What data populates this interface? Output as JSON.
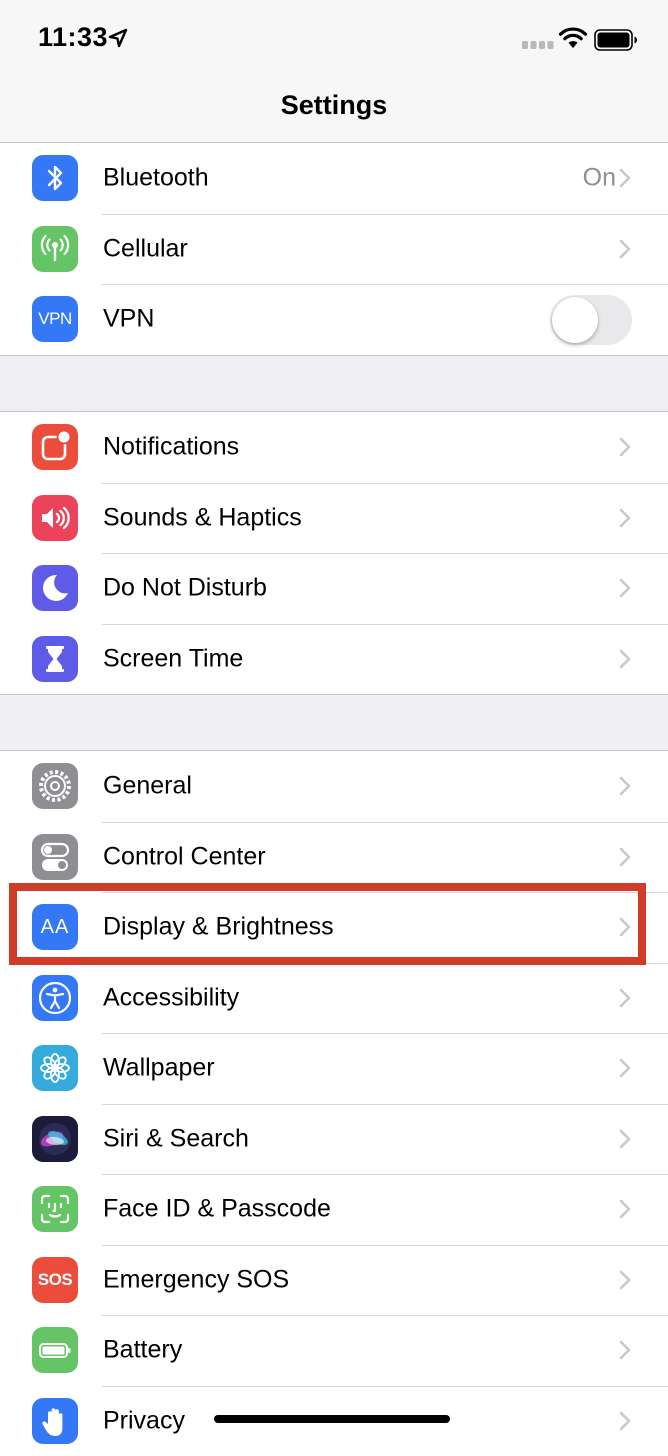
{
  "status_bar": {
    "time": "11:33",
    "icons": [
      "location-arrow-icon",
      "cellular-signal-icon",
      "wifi-icon",
      "battery-icon"
    ]
  },
  "nav": {
    "title": "Settings"
  },
  "groups": [
    {
      "rows": [
        {
          "id": "bluetooth",
          "label": "Bluetooth",
          "value": "On",
          "icon": "bluetooth-icon",
          "icon_color": "#3478f6",
          "accessory": "chevron"
        },
        {
          "id": "cellular",
          "label": "Cellular",
          "icon": "cellular-antenna-icon",
          "icon_color": "#65c466",
          "accessory": "chevron"
        },
        {
          "id": "vpn",
          "label": "VPN",
          "icon": "vpn-icon",
          "icon_text": "VPN",
          "icon_color": "#3478f6",
          "accessory": "toggle",
          "toggle_on": false
        }
      ]
    },
    {
      "rows": [
        {
          "id": "notifications",
          "label": "Notifications",
          "icon": "notifications-icon",
          "icon_color": "#eb4d3d",
          "accessory": "chevron"
        },
        {
          "id": "sounds",
          "label": "Sounds & Haptics",
          "icon": "speaker-icon",
          "icon_color": "#eb445a",
          "accessory": "chevron"
        },
        {
          "id": "dnd",
          "label": "Do Not Disturb",
          "icon": "moon-icon",
          "icon_color": "#5e5ce6",
          "accessory": "chevron"
        },
        {
          "id": "screen_time",
          "label": "Screen Time",
          "icon": "hourglass-icon",
          "icon_color": "#5e5ce6",
          "accessory": "chevron"
        }
      ]
    },
    {
      "rows": [
        {
          "id": "general",
          "label": "General",
          "icon": "gear-icon",
          "icon_color": "#8e8e93",
          "accessory": "chevron"
        },
        {
          "id": "control_center",
          "label": "Control Center",
          "icon": "switches-icon",
          "icon_color": "#8e8e93",
          "accessory": "chevron"
        },
        {
          "id": "display",
          "label": "Display & Brightness",
          "icon": "text-size-icon",
          "icon_text": "AA",
          "icon_color": "#3478f6",
          "accessory": "chevron",
          "highlighted": true
        },
        {
          "id": "accessibility",
          "label": "Accessibility",
          "icon": "accessibility-icon",
          "icon_color": "#3478f6",
          "accessory": "chevron"
        },
        {
          "id": "wallpaper",
          "label": "Wallpaper",
          "icon": "flower-icon",
          "icon_color": "#35aadc",
          "accessory": "chevron"
        },
        {
          "id": "siri",
          "label": "Siri & Search",
          "icon": "siri-icon",
          "icon_color": "#1c1c3a",
          "accessory": "chevron"
        },
        {
          "id": "face_id",
          "label": "Face ID & Passcode",
          "icon": "face-id-icon",
          "icon_color": "#65c466",
          "accessory": "chevron"
        },
        {
          "id": "sos",
          "label": "Emergency SOS",
          "icon": "sos-icon",
          "icon_text": "SOS",
          "icon_color": "#eb4d3d",
          "accessory": "chevron"
        },
        {
          "id": "battery",
          "label": "Battery",
          "icon": "battery-settings-icon",
          "icon_color": "#65c466",
          "accessory": "chevron"
        },
        {
          "id": "privacy",
          "label": "Privacy",
          "icon": "hand-icon",
          "icon_color": "#3478f6",
          "accessory": "chevron"
        }
      ]
    }
  ],
  "highlight_color": "#d03c27"
}
